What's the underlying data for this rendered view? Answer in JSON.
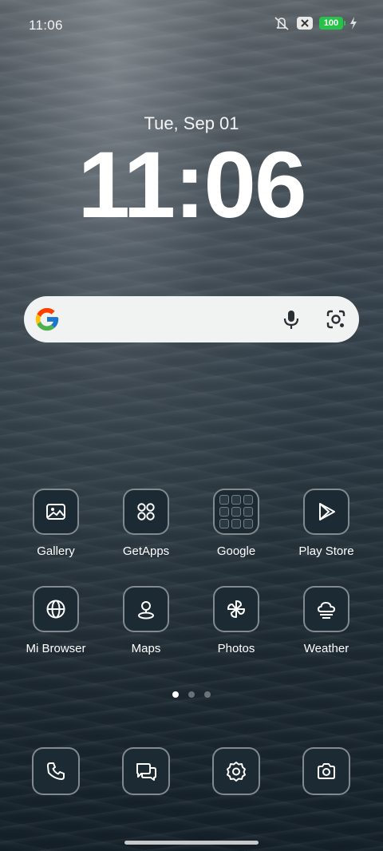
{
  "status_bar": {
    "time": "11:06",
    "battery": "100",
    "icons": [
      "mute-icon",
      "sim-x-icon",
      "battery-icon",
      "charging-icon"
    ]
  },
  "clock_widget": {
    "date": "Tue, Sep 01",
    "time": "11:06"
  },
  "search": {
    "icons": [
      "google-g-icon",
      "mic-icon",
      "lens-icon"
    ]
  },
  "apps": [
    {
      "label": "Gallery",
      "icon": "gallery-icon"
    },
    {
      "label": "GetApps",
      "icon": "getapps-icon"
    },
    {
      "label": "Google",
      "icon": "folder-icon"
    },
    {
      "label": "Play Store",
      "icon": "play-store-icon"
    },
    {
      "label": "Mi Browser",
      "icon": "globe-icon"
    },
    {
      "label": "Maps",
      "icon": "map-pin-icon"
    },
    {
      "label": "Photos",
      "icon": "pinwheel-icon"
    },
    {
      "label": "Weather",
      "icon": "weather-icon"
    }
  ],
  "pages": {
    "count": 3,
    "active": 1
  },
  "dock": [
    {
      "icon": "phone-icon"
    },
    {
      "icon": "messages-icon"
    },
    {
      "icon": "settings-icon"
    },
    {
      "icon": "camera-icon"
    }
  ],
  "colors": {
    "accent_battery": "#27c24a",
    "icon_bg": "#1c2a33",
    "search_bg": "#f1f2f2"
  }
}
